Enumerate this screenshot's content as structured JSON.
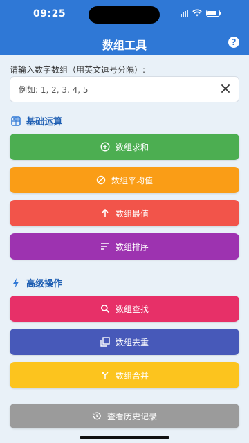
{
  "status_bar": {
    "time": "09:25"
  },
  "header": {
    "title": "数组工具",
    "help_icon": "help-icon"
  },
  "input": {
    "prompt": "请输入数字数组（用英文逗号分隔）:",
    "placeholder": "例如: 1, 2, 3, 4, 5",
    "value": ""
  },
  "sections": {
    "basic": {
      "title": "基础运算",
      "icon": "calculator-icon"
    },
    "advanced": {
      "title": "高级操作",
      "icon": "bolt-icon"
    }
  },
  "buttons": {
    "sum": {
      "label": "数组求和",
      "color": "#4cae51",
      "icon": "add-circle-icon"
    },
    "avg": {
      "label": "数组平均值",
      "color": "#fa9d16",
      "icon": "average-icon"
    },
    "max": {
      "label": "数组最值",
      "color": "#f2544a",
      "icon": "arrow-up-icon"
    },
    "sort": {
      "label": "数组排序",
      "color": "#9d33b0",
      "icon": "sort-icon"
    },
    "search": {
      "label": "数组查找",
      "color": "#e73068",
      "icon": "search-icon"
    },
    "dedupe": {
      "label": "数组去重",
      "color": "#4759b9",
      "icon": "copy-icon"
    },
    "merge": {
      "label": "数组合并",
      "color": "#fcc41e",
      "icon": "merge-icon"
    },
    "history": {
      "label": "查看历史记录",
      "color": "#9b9b9b",
      "icon": "history-icon"
    }
  }
}
